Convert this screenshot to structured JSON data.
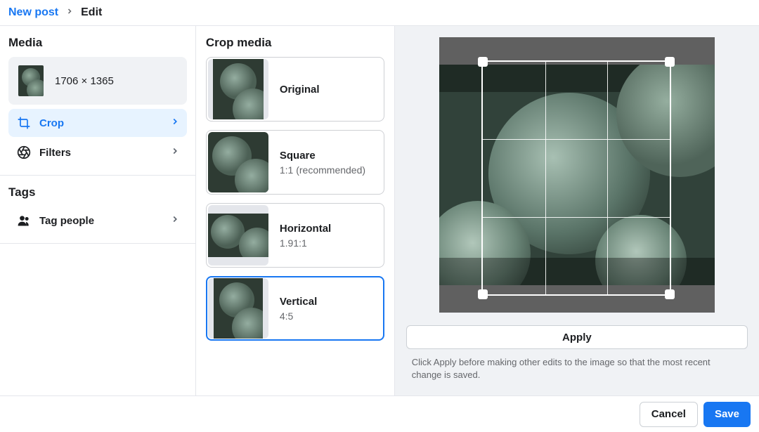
{
  "breadcrumb": {
    "parent": "New post",
    "current": "Edit"
  },
  "sidebar": {
    "media_title": "Media",
    "media_dimensions": "1706 × 1365",
    "nav": {
      "crop": "Crop",
      "filters": "Filters"
    },
    "tags_title": "Tags",
    "tag_people": "Tag people"
  },
  "crop": {
    "title": "Crop media",
    "options": [
      {
        "name": "Original",
        "sub": ""
      },
      {
        "name": "Square",
        "sub": "1:1 (recommended)"
      },
      {
        "name": "Horizontal",
        "sub": "1.91:1"
      },
      {
        "name": "Vertical",
        "sub": "4:5"
      }
    ]
  },
  "preview": {
    "apply": "Apply",
    "hint": "Click Apply before making other edits to the image so that the most recent change is saved."
  },
  "footer": {
    "cancel": "Cancel",
    "save": "Save"
  }
}
